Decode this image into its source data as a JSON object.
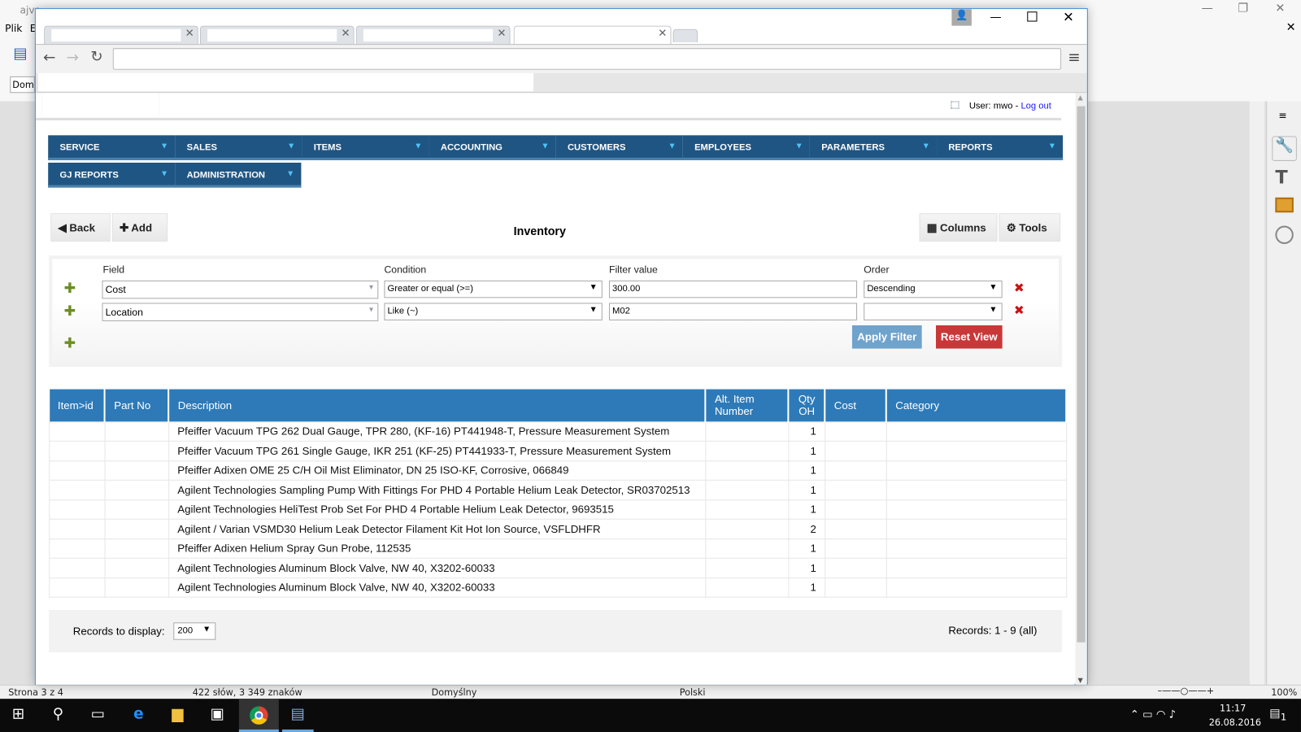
{
  "writer": {
    "title": "ajvs...",
    "menu": [
      "Plik",
      "E"
    ],
    "style_box": "Dom",
    "status": {
      "page": "Strona 3 z 4",
      "words": "422 słów, 3 349 znaków",
      "style": "Domyślny",
      "language": "Polski",
      "zoom": "100%"
    }
  },
  "taskbar": {
    "time": "11:17",
    "date": "26.08.2016",
    "notifications": "1"
  },
  "page": {
    "user_label": "User: mwo - ",
    "logout": "Log out",
    "nav": [
      {
        "label": "SERVICE"
      },
      {
        "label": "SALES"
      },
      {
        "label": "ITEMS"
      },
      {
        "label": "ACCOUNTING"
      },
      {
        "label": "CUSTOMERS"
      },
      {
        "label": "EMPLOYEES"
      },
      {
        "label": "PARAMETERS"
      },
      {
        "label": "REPORTS"
      },
      {
        "label": "GJ REPORTS"
      },
      {
        "label": "ADMINISTRATION"
      }
    ],
    "toolbar": {
      "back": "Back",
      "add": "Add",
      "title": "Inventory",
      "columns": "Columns",
      "tools": "Tools"
    },
    "filter": {
      "headers": {
        "field": "Field",
        "condition": "Condition",
        "value": "Filter value",
        "order": "Order"
      },
      "rows": [
        {
          "field": "Cost",
          "condition": "Greater or equal (>=)",
          "value": "300.00",
          "order": "Descending"
        },
        {
          "field": "Location",
          "condition": "Like (~)",
          "value": "M02",
          "order": ""
        }
      ],
      "apply": "Apply Filter",
      "reset": "Reset View"
    },
    "table": {
      "columns": [
        "Item>id",
        "Part No",
        "Description",
        "Alt. Item Number",
        "Qty OH",
        "Cost",
        "Category"
      ],
      "rows": [
        {
          "desc": "Pfeiffer Vacuum TPG 262 Dual Gauge, TPR 280, (KF-16) PT441948-T, Pressure Measurement System",
          "qty": "1"
        },
        {
          "desc": "Pfeiffer Vacuum TPG 261 Single Gauge, IKR 251 (KF-25) PT441933-T, Pressure Measurement System",
          "qty": "1"
        },
        {
          "desc": "Pfeiffer Adixen OME 25 C/H Oil Mist Eliminator, DN 25 ISO-KF, Corrosive, 066849",
          "qty": "1"
        },
        {
          "desc": "Agilent Technologies Sampling Pump With Fittings For PHD 4 Portable Helium Leak Detector, SR03702513",
          "qty": "1"
        },
        {
          "desc": "Agilent Technologies HeliTest Prob Set For PHD 4 Portable Helium Leak Detector, 9693515",
          "qty": "1"
        },
        {
          "desc": "Agilent / Varian VSMD30 Helium Leak Detector Filament Kit Hot Ion Source, VSFLDHFR",
          "qty": "2"
        },
        {
          "desc": "Pfeiffer Adixen Helium Spray Gun Probe, 112535",
          "qty": "1"
        },
        {
          "desc": "Agilent Technologies Aluminum Block Valve, NW 40, X3202-60033",
          "qty": "1"
        },
        {
          "desc": "Agilent Technologies Aluminum Block Valve, NW 40, X3202-60033",
          "qty": "1"
        }
      ]
    },
    "footer": {
      "records_label": "Records to display:",
      "records_value": "200",
      "records_info": "Records: 1 - 9 (all)"
    }
  },
  "colors": {
    "nav": "#1f5582",
    "table_header": "#2e7ab8",
    "apply": "#6fa3cc",
    "reset": "#c83838",
    "link": "#1a1aff"
  }
}
